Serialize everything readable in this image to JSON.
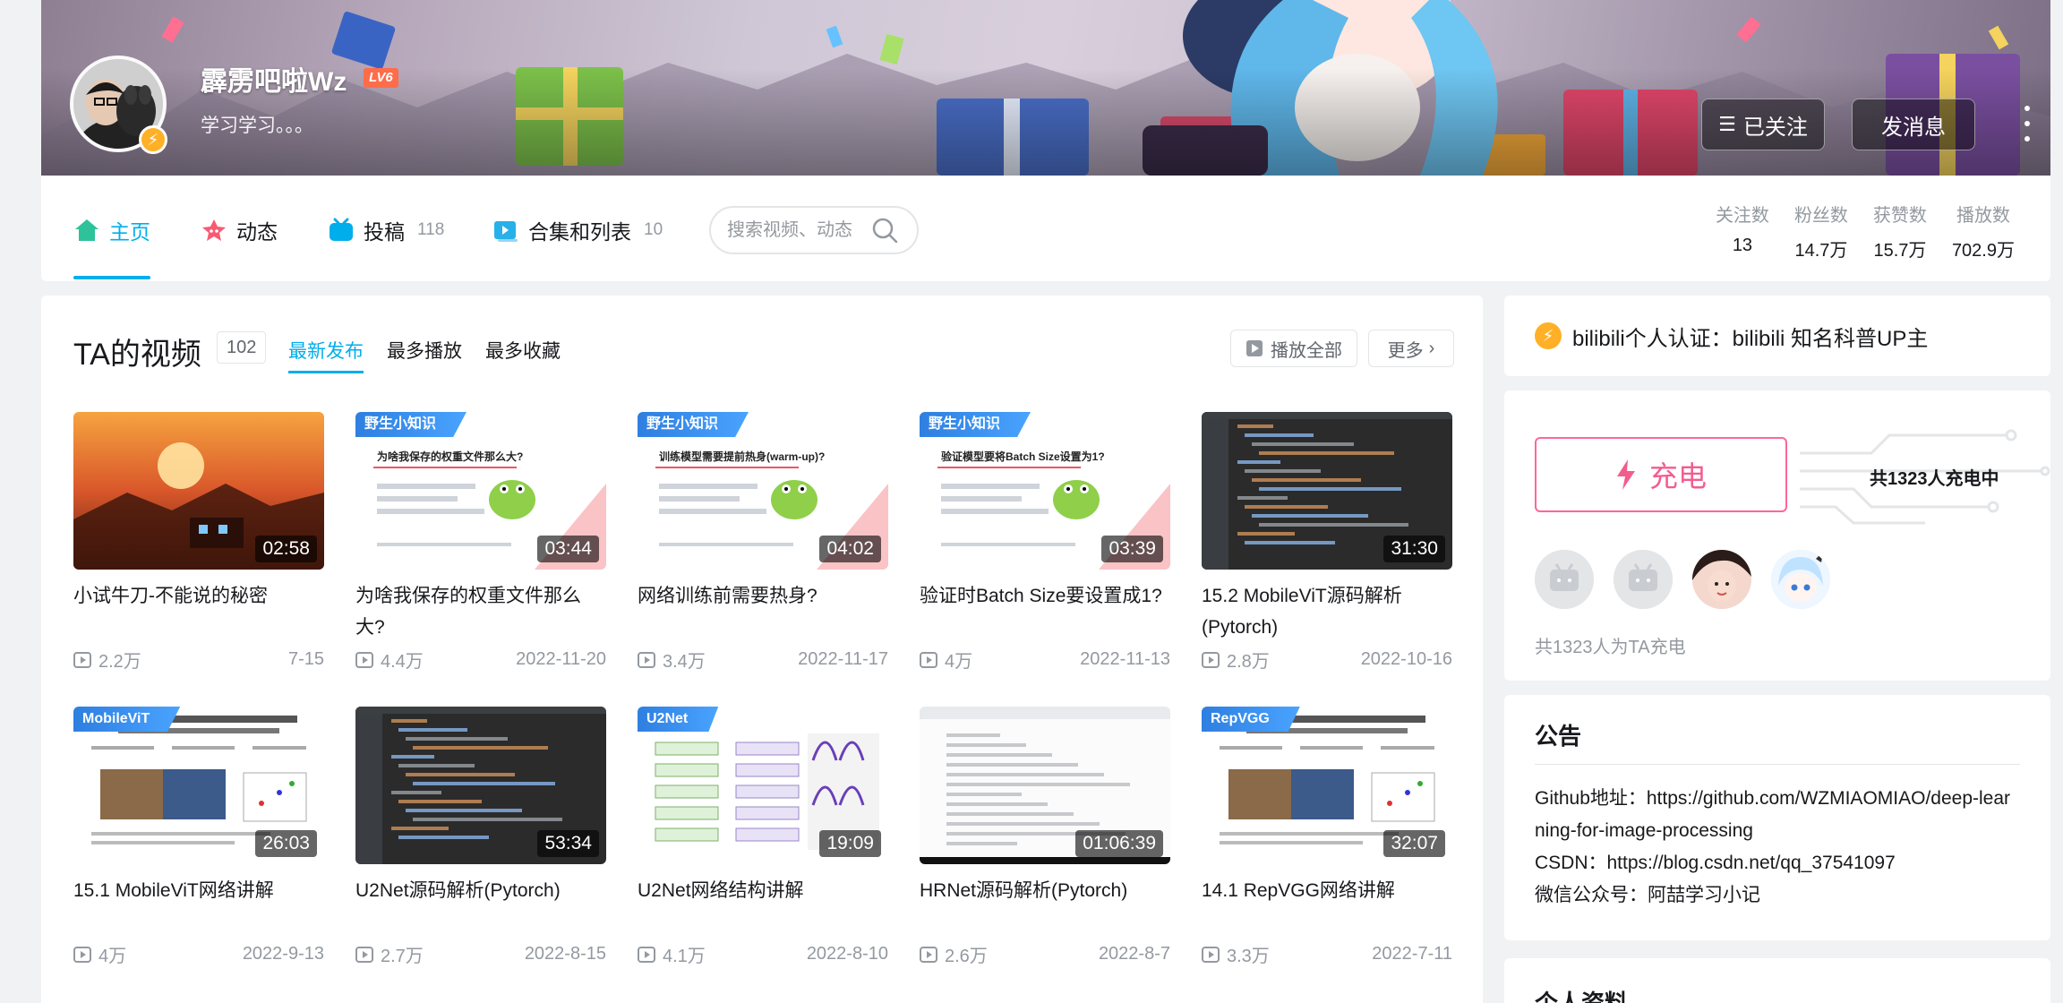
{
  "user": {
    "name": "霹雳吧啦Wz",
    "level": "LV6",
    "sign": "学习学习。。。"
  },
  "actions": {
    "follow_label": "已关注",
    "message_label": "发消息"
  },
  "nav": {
    "home": "主页",
    "dynamic": "动态",
    "uploads": "投稿",
    "uploads_count": "118",
    "collections": "合集和列表",
    "collections_count": "10",
    "search_placeholder": "搜索视频、动态"
  },
  "stats": [
    {
      "label": "关注数",
      "value": "13"
    },
    {
      "label": "粉丝数",
      "value": "14.7万"
    },
    {
      "label": "获赞数",
      "value": "15.7万"
    },
    {
      "label": "播放数",
      "value": "702.9万"
    }
  ],
  "videos_section": {
    "title": "TA的视频",
    "count": "102",
    "sort_tabs": [
      "最新发布",
      "最多播放",
      "最多收藏"
    ],
    "play_all": "播放全部",
    "more": "更多"
  },
  "videos": [
    {
      "title": "小试牛刀-不能说的秘密",
      "duration": "02:58",
      "plays": "2.2万",
      "date": "7-15",
      "thumb": "sunset",
      "ribbon": ""
    },
    {
      "title": "为啥我保存的权重文件那么大?",
      "duration": "03:44",
      "plays": "4.4万",
      "date": "2022-11-20",
      "thumb": "slide",
      "ribbon": "野生小知识",
      "slide_text": "为啥我保存的权重文件那么大?"
    },
    {
      "title": "网络训练前需要热身?",
      "duration": "04:02",
      "plays": "3.4万",
      "date": "2022-11-17",
      "thumb": "slide",
      "ribbon": "野生小知识",
      "slide_text": "训练模型需要提前热身(warm-up)?"
    },
    {
      "title": "验证时Batch Size要设置成1?",
      "duration": "03:39",
      "plays": "4万",
      "date": "2022-11-13",
      "thumb": "slide",
      "ribbon": "野生小知识",
      "slide_text": "验证模型要将Batch Size设置为1?"
    },
    {
      "title": "15.2 MobileViT源码解析(Pytorch)",
      "duration": "31:30",
      "plays": "2.8万",
      "date": "2022-10-16",
      "thumb": "code",
      "ribbon": ""
    },
    {
      "title": "15.1 MobileViT网络讲解",
      "duration": "26:03",
      "plays": "4万",
      "date": "2022-9-13",
      "thumb": "paper",
      "ribbon": "MobileViT"
    },
    {
      "title": "U2Net源码解析(Pytorch)",
      "duration": "53:34",
      "plays": "2.7万",
      "date": "2022-8-15",
      "thumb": "code",
      "ribbon": ""
    },
    {
      "title": "U2Net网络结构讲解",
      "duration": "19:09",
      "plays": "4.1万",
      "date": "2022-8-10",
      "thumb": "diagram",
      "ribbon": "U2Net"
    },
    {
      "title": "HRNet源码解析(Pytorch)",
      "duration": "01:06:39",
      "plays": "2.6万",
      "date": "2022-8-7",
      "thumb": "doc",
      "ribbon": ""
    },
    {
      "title": "14.1 RepVGG网络讲解",
      "duration": "32:07",
      "plays": "3.3万",
      "date": "2022-7-11",
      "thumb": "paper",
      "ribbon": "RepVGG"
    }
  ],
  "verify": {
    "text": "bilibili个人认证：bilibili 知名科普UP主"
  },
  "charge": {
    "button": "充电",
    "count_prefix": "共",
    "count": "1323",
    "count_suffix": "人充电中",
    "note": "共1323人为TA充电"
  },
  "notice": {
    "title": "公告",
    "lines": [
      "Github地址：https://github.com/WZMIAOMIAO/deep-learning-for-image-processing",
      "CSDN：https://blog.csdn.net/qq_37541097",
      "微信公众号：阿喆学习小记"
    ]
  },
  "profile": {
    "title": "个人资料"
  },
  "colors": {
    "accent": "#00aeec",
    "pink": "#f25d8e",
    "gold": "#ffb027"
  }
}
